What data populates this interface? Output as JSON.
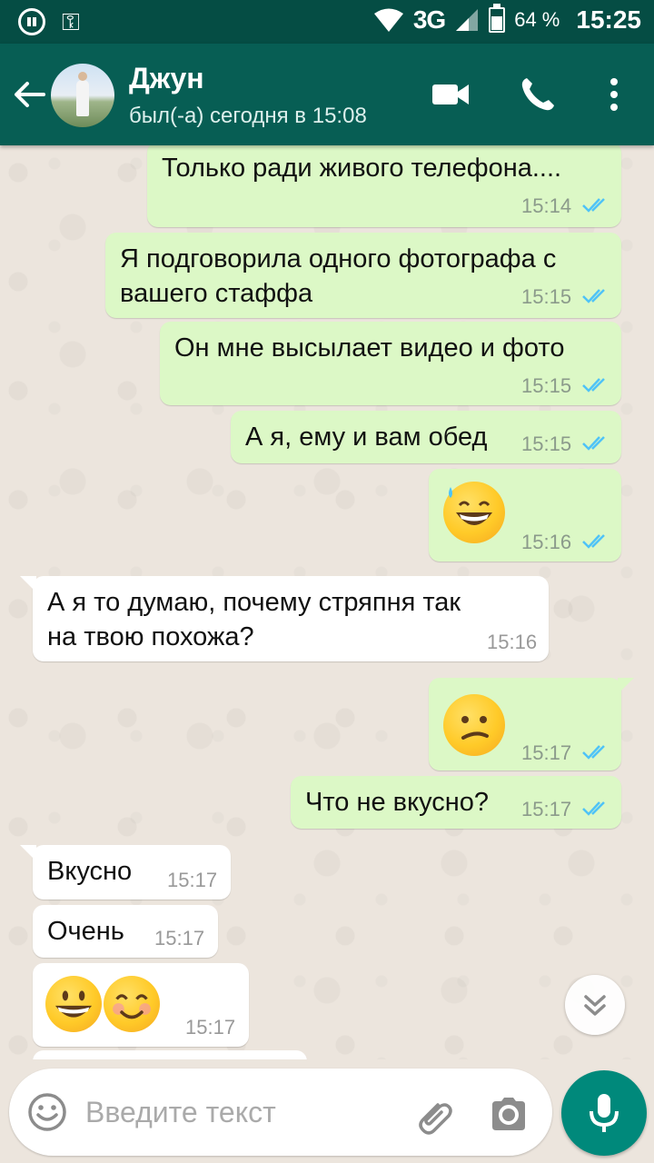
{
  "status_bar": {
    "network": "3G",
    "battery_percent": "64 %",
    "battery_level": 0.64,
    "time": "15:25"
  },
  "header": {
    "contact_name": "Джун",
    "last_seen": "был(-а) сегодня в 15:08",
    "icons": [
      "back-arrow-icon",
      "avatar",
      "video-call-icon",
      "phone-icon",
      "more-vert-icon"
    ]
  },
  "messages": [
    {
      "dir": "out",
      "text": "Только ради живого телефона....",
      "time": "15:14",
      "read": true
    },
    {
      "dir": "out",
      "text_line1": "Я подговорила одного фотографа с",
      "text_line2": "вашего стаффа",
      "time": "15:15",
      "read": true
    },
    {
      "dir": "out",
      "text": "Он мне высылает видео и фото",
      "time": "15:15",
      "read": true
    },
    {
      "dir": "out",
      "text": "А я, ему и вам обед",
      "time": "15:15",
      "read": true
    },
    {
      "dir": "out",
      "emoji": "grinning-sweat",
      "time": "15:16",
      "read": true
    },
    {
      "dir": "in",
      "text_line1": "А я то думаю, почему стряпня так",
      "text_line2": "на твою похожа?",
      "time": "15:16"
    },
    {
      "dir": "out",
      "emoji": "confused-face",
      "time": "15:17",
      "read": true
    },
    {
      "dir": "out",
      "text": "Что не вкусно?",
      "time": "15:17",
      "read": true
    },
    {
      "dir": "in",
      "text": "Вкусно",
      "time": "15:17"
    },
    {
      "dir": "in",
      "text": "Очень",
      "time": "15:17"
    },
    {
      "dir": "in",
      "emoji": "grinning + smiling-eyes",
      "time": "15:17"
    }
  ],
  "composer": {
    "placeholder": "Введите текст",
    "icons": [
      "emoji-icon",
      "attach-icon",
      "camera-icon",
      "mic-icon"
    ]
  },
  "colors": {
    "status_bar": "#054d44",
    "app_bar": "#075e54",
    "outgoing_bubble": "#dcf8c6",
    "incoming_bubble": "#ffffff",
    "read_ticks": "#4fc3f7",
    "mic_button": "#00897b"
  }
}
